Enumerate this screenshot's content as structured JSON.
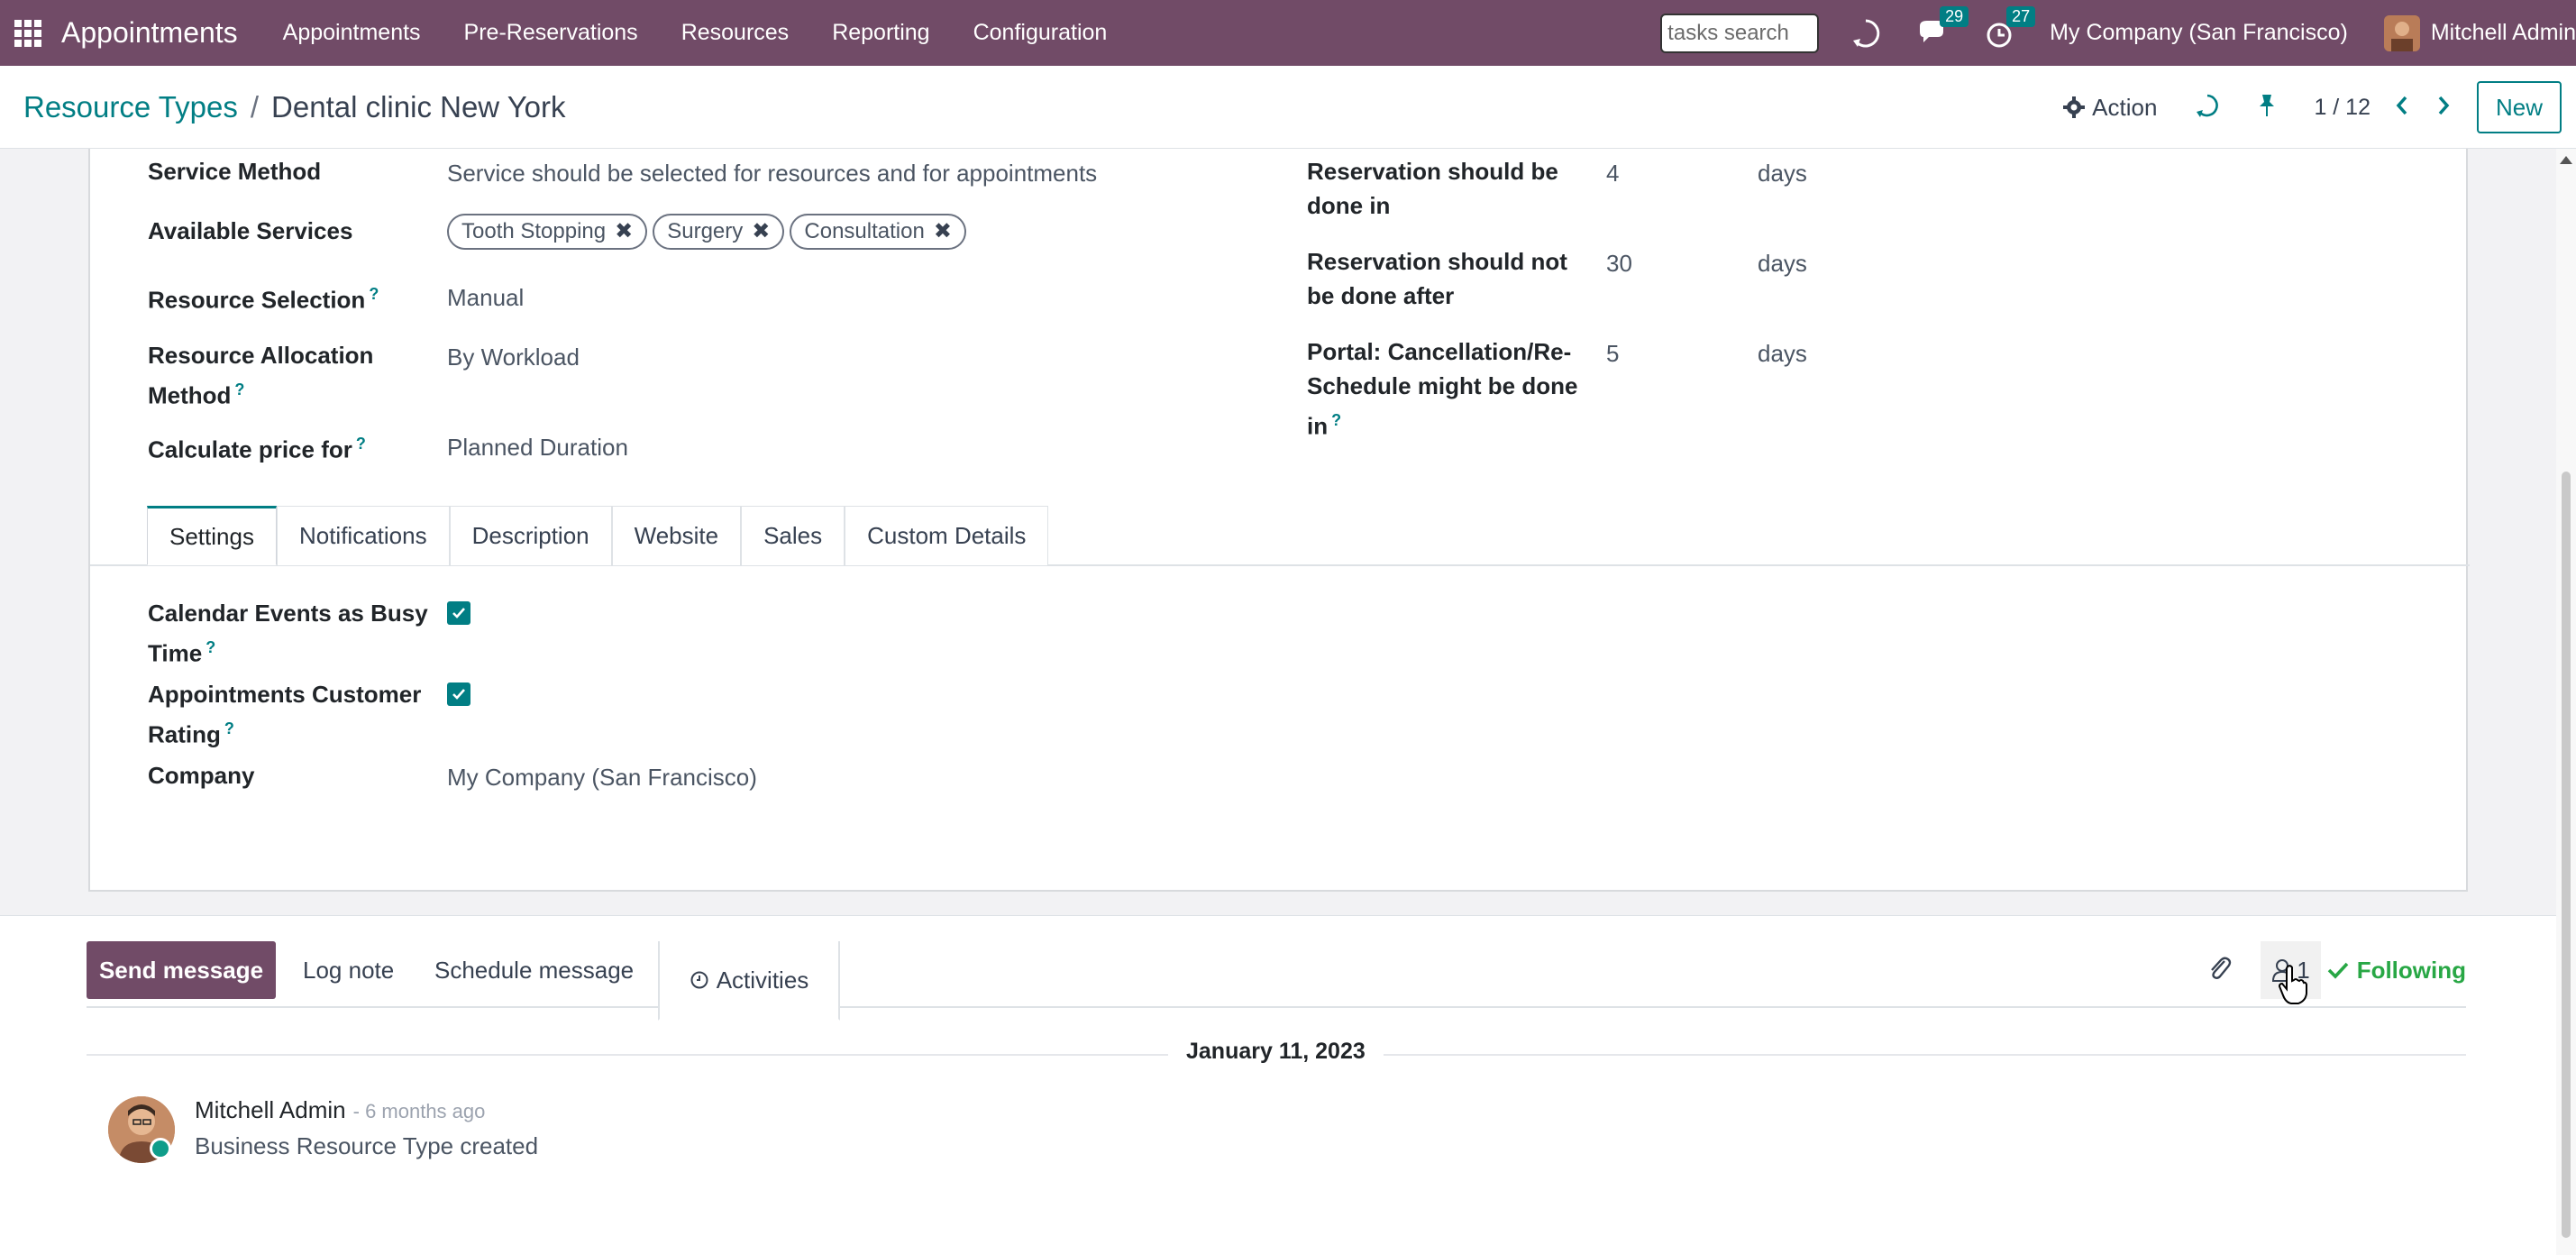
{
  "navbar": {
    "brand": "Appointments",
    "menu": [
      "Appointments",
      "Pre-Reservations",
      "Resources",
      "Reporting",
      "Configuration"
    ],
    "search_value": "tasks search",
    "messages_count": "29",
    "activities_count": "27",
    "company": "My Company (San Francisco)",
    "user": "Mitchell Admin"
  },
  "control_panel": {
    "breadcrumb_parent": "Resource Types",
    "breadcrumb_separator": "/",
    "breadcrumb_current": "Dental clinic New York",
    "action_label": "Action",
    "pager": "1 / 12",
    "new_label": "New"
  },
  "form": {
    "left": {
      "service_method_label": "Service Method",
      "service_method_value": "Service should be selected for resources and for appointments",
      "available_services_label": "Available Services",
      "available_services": [
        "Tooth Stopping",
        "Surgery",
        "Consultation"
      ],
      "resource_selection_label": "Resource Selection",
      "resource_selection_value": "Manual",
      "allocation_label_1": "Resource Allocation",
      "allocation_label_2": "Method",
      "allocation_value": "By Workload",
      "price_label": "Calculate price for",
      "price_value": "Planned Duration"
    },
    "right": {
      "res_done_in_label_1": "Reservation should be",
      "res_done_in_label_2": "done in",
      "res_done_in_value": "4",
      "res_done_in_unit": "days",
      "res_not_after_label_1": "Reservation should not",
      "res_not_after_label_2": "be done after",
      "res_not_after_value": "30",
      "res_not_after_unit": "days",
      "portal_label_1": "Portal: Cancellation/Re-",
      "portal_label_2": "Schedule might be done",
      "portal_label_3": "in",
      "portal_value": "5",
      "portal_unit": "days"
    },
    "tabs": [
      "Settings",
      "Notifications",
      "Description",
      "Website",
      "Sales",
      "Custom Details"
    ],
    "settings": {
      "calendar_label_1": "Calendar Events as Busy",
      "calendar_label_2": "Time",
      "calendar_checked": true,
      "rating_label_1": "Appointments Customer",
      "rating_label_2": "Rating",
      "rating_checked": true,
      "company_label": "Company",
      "company_value": "My Company (San Francisco)"
    },
    "help_marker": "?"
  },
  "chatter": {
    "send_message": "Send message",
    "log_note": "Log note",
    "schedule_message": "Schedule message",
    "activities": "Activities",
    "followers_count": "1",
    "following_label": "Following",
    "date_separator": "January 11, 2023",
    "message": {
      "author": "Mitchell Admin",
      "time": "- 6 months ago",
      "body": "Business Resource Type created"
    }
  },
  "colors": {
    "brand": "#714b67",
    "accent": "#017e84",
    "following": "#28a745"
  }
}
